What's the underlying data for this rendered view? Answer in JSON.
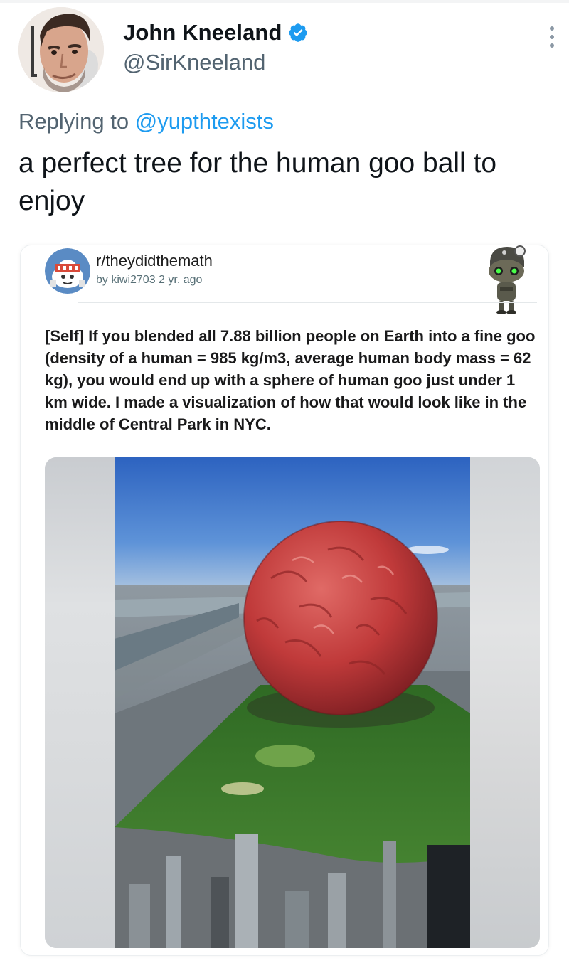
{
  "tweet": {
    "author": {
      "display_name": "John Kneeland",
      "handle": "@SirKneeland",
      "verified": true,
      "verified_color": "#1d9bf0"
    },
    "replying_prefix": "Replying to ",
    "replying_handle": "@yupthtexists",
    "text": "a perfect tree for the human goo ball to enjoy",
    "more_icon": "more-vertical-icon"
  },
  "embedded_post": {
    "subreddit": "r/theydidthemath",
    "meta": "by kiwi2703  2 yr. ago",
    "text": "[Self] If you blended all 7.88 billion people on Earth into a fine goo (density of a human = 985 kg/m3, average human body mass = 62 kg), you would end up with a sphere of human goo just under 1 km wide. I made a visualization of how that would look like in the middle of Central Park in NYC."
  },
  "colors": {
    "link_blue": "#1d9bf0",
    "secondary_text": "#536471",
    "goo_red": "#c23a3d",
    "sky_blue": "#3f78c8",
    "park_green": "#3d7a2c"
  }
}
